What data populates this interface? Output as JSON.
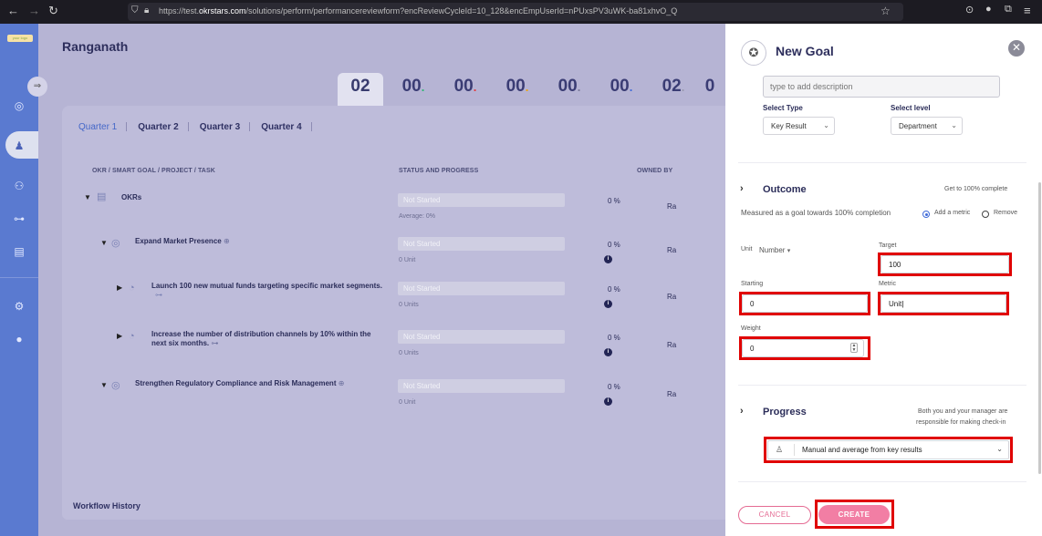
{
  "browser": {
    "url_prefix": "https://test.",
    "url_host": "okrstars.com",
    "url_path": "/solutions/perform/performancereviewform?encReviewCycleId=10_128&encEmpUserId=nPUxsPV3uWK-ba81xhvO_Q",
    "back_icon": "arrow-left-icon",
    "forward_icon": "arrow-right-icon",
    "reload_icon": "reload-icon",
    "bookmark_icon": "star-icon"
  },
  "sidebar": {
    "logo_text": "your logo"
  },
  "main": {
    "title": "Ranganath",
    "stats": [
      "02",
      "00",
      "00",
      "00",
      "00",
      "00",
      "02",
      "0"
    ],
    "stat_dot_colors": [
      "",
      "#2bb673",
      "#e5383b",
      "#f0a202",
      "#7a7a9a",
      "#3f6ad8",
      "#9a9ab0",
      ""
    ],
    "quarters": [
      "Quarter 1",
      "Quarter 2",
      "Quarter 3",
      "Quarter 4"
    ],
    "columns": {
      "okr": "OKR / SMART GOAL / PROJECT / TASK",
      "status": "STATUS AND PROGRESS",
      "owned_by": "OWNED BY"
    },
    "rows": [
      {
        "title": "OKRs",
        "status": "Not Started",
        "sub": "Average: 0%",
        "pct": "0 %",
        "owner": "Ra"
      },
      {
        "title": "Expand Market Presence",
        "status": "Not Started",
        "sub": "0 Unit",
        "pct": "0 %",
        "owner": "Ra"
      },
      {
        "title": "Launch 100 new mutual funds targeting specific market segments.",
        "status": "Not Started",
        "sub": "0 Units",
        "pct": "0 %",
        "owner": "Ra"
      },
      {
        "title_line1": "Increase the number of distribution channels by 10% within the",
        "title_line2": "next six months.",
        "status": "Not Started",
        "sub": "0 Units",
        "pct": "0 %",
        "owner": "Ra"
      },
      {
        "title": "Strengthen Regulatory Compliance and Risk Management",
        "status": "Not Started",
        "sub": "0 Unit",
        "pct": "0 %",
        "owner": "Ra"
      }
    ],
    "workflow_label": "Workflow History"
  },
  "panel": {
    "title": "New Goal",
    "description_placeholder": "type to add description",
    "select_type_label": "Select Type",
    "select_type_value": "Key Result",
    "select_level_label": "Select level",
    "select_level_value": "Department",
    "outcome": {
      "title": "Outcome",
      "hint": "Get to 100% complete",
      "measured_text": "Measured as a goal towards 100% completion",
      "add_metric": "Add a metric",
      "remove": "Remove",
      "unit_label": "Unit",
      "unit_value": "Number",
      "target_label": "Target",
      "target_value": "100",
      "starting_label": "Starting",
      "starting_value": "0",
      "metric_label": "Metric",
      "metric_value": "Unit",
      "weight_label": "Weight",
      "weight_value": "0"
    },
    "progress": {
      "title": "Progress",
      "hint_line1": "Both you and your manager are",
      "hint_line2": "responsible for making check-in",
      "method": "Manual and average from key results"
    },
    "cancel_label": "CANCEL",
    "create_label": "CREATE"
  }
}
